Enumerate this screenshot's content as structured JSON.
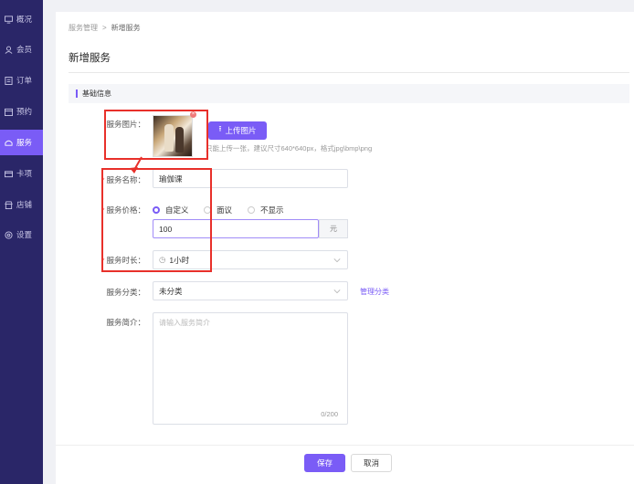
{
  "sidebar": {
    "items": [
      {
        "label": "概况",
        "icon": "screen-icon",
        "active": false
      },
      {
        "label": "会员",
        "icon": "user-icon",
        "active": false
      },
      {
        "label": "订单",
        "icon": "list-icon",
        "active": false
      },
      {
        "label": "预约",
        "icon": "calendar-icon",
        "active": false
      },
      {
        "label": "服务",
        "icon": "service-icon",
        "active": true
      },
      {
        "label": "卡项",
        "icon": "card-icon",
        "active": false
      },
      {
        "label": "店铺",
        "icon": "store-icon",
        "active": false
      },
      {
        "label": "设置",
        "icon": "gear-icon",
        "active": false
      }
    ]
  },
  "breadcrumb": {
    "parent": "服务管理",
    "separator": ">",
    "current": "新增服务"
  },
  "page_title": "新增服务",
  "section": {
    "title": "基础信息"
  },
  "form": {
    "image": {
      "label": "服务图片：",
      "upload_button": "上传图片",
      "hint": "只能上传一张，建议尺寸640*640px，格式jpg\\bmp\\png",
      "remove": "×"
    },
    "name": {
      "label": "服务名称：",
      "value": "瑜伽课"
    },
    "price": {
      "label": "服务价格：",
      "options": [
        "自定义",
        "面议",
        "不显示"
      ],
      "selected": "自定义",
      "value": "100",
      "unit": "元"
    },
    "duration": {
      "label": "服务时长：",
      "value": "1小时"
    },
    "category": {
      "label": "服务分类：",
      "value": "未分类",
      "manage_link": "管理分类"
    },
    "intro": {
      "label": "服务简介：",
      "placeholder": "请输入服务简介",
      "counter": "0/200"
    }
  },
  "actions": {
    "save": "保存",
    "cancel": "取消"
  },
  "colors": {
    "accent": "#7a5cf6",
    "sidebar": "#2a2668",
    "highlight": "#e8302a"
  }
}
